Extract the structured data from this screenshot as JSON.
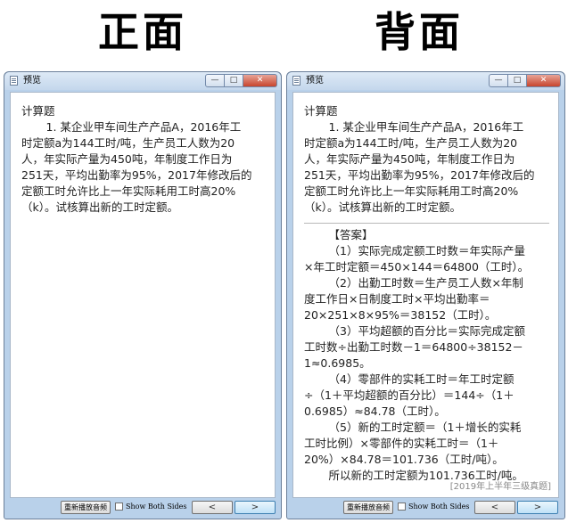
{
  "headings": {
    "front": "正面",
    "back": "背面"
  },
  "window": {
    "title": "预览",
    "controls": {
      "minimize": "—",
      "maximize": "□",
      "close": "✕"
    }
  },
  "question": {
    "section": "计算题",
    "lines": [
      "1. 某企业甲车间生产产品A，2016年工",
      "时定额a为144工时/吨，生产员工人数为20",
      "人，年实际产量为450吨，年制度工作日为",
      "251天，平均出勤率为95%，2017年修改后的",
      "定额工时允许比上一年实际耗用工时高20%",
      "（k）。试核算出新的工时定额。"
    ]
  },
  "answer": {
    "header": "【答案】",
    "lines": [
      {
        "text": "（1）实际完成定额工时数＝年实际产量",
        "indent": true
      },
      {
        "text": "×年工时定额＝450×144＝64800（工时）。",
        "indent": false
      },
      {
        "text": "（2）出勤工时数＝生产员工人数×年制",
        "indent": true
      },
      {
        "text": "度工作日×日制度工时×平均出勤率＝",
        "indent": false
      },
      {
        "text": "20×251×8×95%＝38152（工时）。",
        "indent": false
      },
      {
        "text": "（3）平均超额的百分比＝实际完成定额",
        "indent": true
      },
      {
        "text": "工时数÷出勤工时数－1＝64800÷38152－",
        "indent": false
      },
      {
        "text": "1≈0.6985。",
        "indent": false
      },
      {
        "text": "（4）零部件的实耗工时＝年工时定额",
        "indent": true
      },
      {
        "text": "÷（1＋平均超额的百分比）＝144÷（1＋",
        "indent": false
      },
      {
        "text": "0.6985）≈84.78（工时）。",
        "indent": false
      },
      {
        "text": "（5）新的工时定额＝（1＋增长的实耗",
        "indent": true
      },
      {
        "text": "工时比例）×零部件的实耗工时＝（1＋",
        "indent": false
      },
      {
        "text": "20%）×84.78＝101.736（工时/吨）。",
        "indent": false
      },
      {
        "text": "所以新的工时定额为101.736工时/吨。",
        "indent": true
      }
    ],
    "source": "[2019年上半年三级真题]"
  },
  "footer": {
    "replay_label": "重新播放音频",
    "show_both_sides_label": "Show Both Sides",
    "show_both_sides_checked": false,
    "prev_label": "<",
    "next_label": ">"
  }
}
